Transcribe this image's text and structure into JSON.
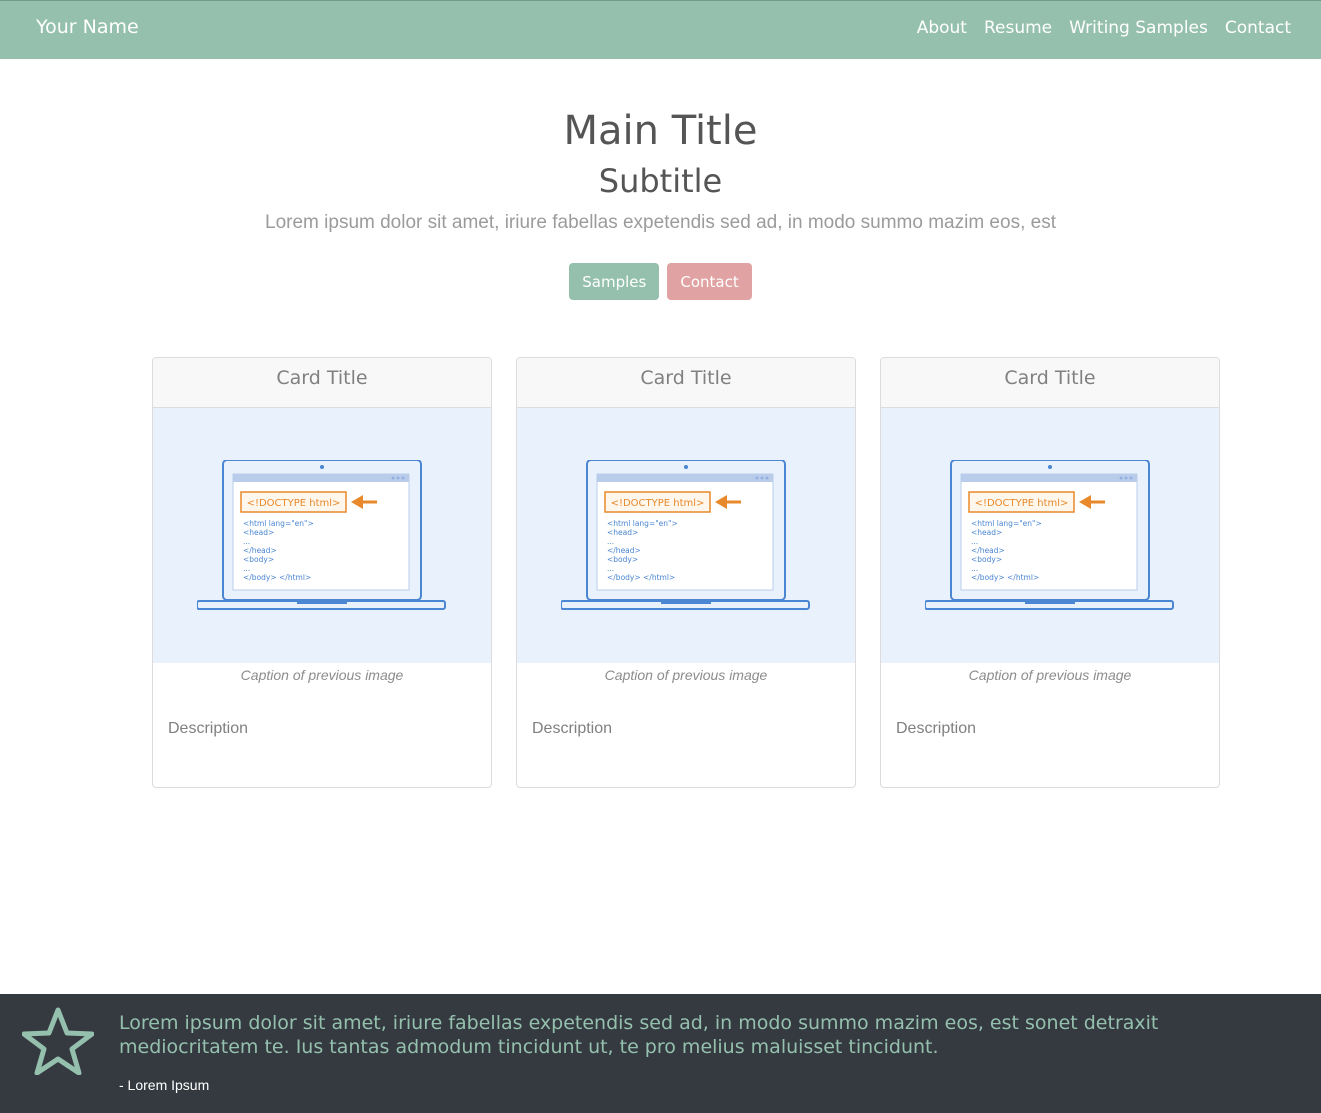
{
  "navbar": {
    "brand": "Your Name",
    "links": [
      "About",
      "Resume",
      "Writing Samples",
      "Contact"
    ]
  },
  "hero": {
    "title": "Main Title",
    "subtitle": "Subtitle",
    "lead": "Lorem ipsum dolor sit amet, iriure fabellas expetendis sed ad, in modo summo mazim eos, est",
    "buttons": {
      "samples": "Samples",
      "contact": "Contact"
    }
  },
  "cards": [
    {
      "title": "Card Title",
      "caption": "Caption of previous image",
      "description": "Description",
      "illustration": {
        "doctype": "<!DOCTYPE html>",
        "lines": [
          "<html lang=\"en\">",
          "<head>",
          "...",
          "</head>",
          "<body>",
          "...",
          "</body> </html>"
        ]
      }
    },
    {
      "title": "Card Title",
      "caption": "Caption of previous image",
      "description": "Description",
      "illustration": {
        "doctype": "<!DOCTYPE html>",
        "lines": [
          "<html lang=\"en\">",
          "<head>",
          "...",
          "</head>",
          "<body>",
          "...",
          "</body> </html>"
        ]
      }
    },
    {
      "title": "Card Title",
      "caption": "Caption of previous image",
      "description": "Description",
      "illustration": {
        "doctype": "<!DOCTYPE html>",
        "lines": [
          "<html lang=\"en\">",
          "<head>",
          "...",
          "</head>",
          "<body>",
          "...",
          "</body> </html>"
        ]
      }
    }
  ],
  "footer": {
    "icon": "star-icon",
    "quote": "Lorem ipsum dolor sit amet, iriure fabellas expetendis sed ad, in modo summo mazim eos, est sonet detraxit mediocritatem te. Ius tantas admodum tincidunt ut, te pro melius maluisset tincidunt.",
    "author": "- Lorem Ipsum"
  },
  "colors": {
    "brand_green": "#95c0ae",
    "brand_pink": "#e0a2a2",
    "footer_bg": "#343a40",
    "image_bg": "#e8f1fc",
    "accent_orange": "#e8892b",
    "laptop_blue": "#4a86d1"
  }
}
